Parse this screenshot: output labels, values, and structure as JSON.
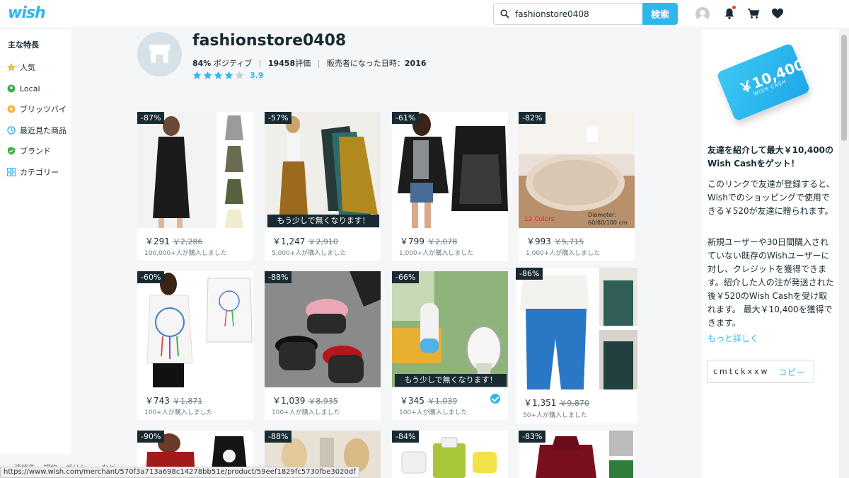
{
  "brand": {
    "logo_text": "wish",
    "accent": "#2fb7ec"
  },
  "search": {
    "value": "fashionstore0408",
    "button_label": "検索"
  },
  "sidebar": {
    "title": "主な特長",
    "items": [
      {
        "label": "人気",
        "icon": "star-icon"
      },
      {
        "label": "Local",
        "icon": "location-pin-icon"
      },
      {
        "label": "ブリッツバイ",
        "icon": "blitz-buy-icon"
      },
      {
        "label": "最近見た商品",
        "icon": "clock-icon"
      },
      {
        "label": "ブランド",
        "icon": "verified-shield-icon"
      },
      {
        "label": "カテゴリー",
        "icon": "grid-icon"
      }
    ]
  },
  "merchant": {
    "name": "fashionstore0408",
    "positive_pct": "84%",
    "positive_label": "ポジティブ",
    "review_count": "19458",
    "review_label": "評価",
    "since_label": "販売者になった日時：",
    "since_year": "2016",
    "rating": "3.9",
    "stars_filled": 4,
    "stars_total": 5
  },
  "products": [
    {
      "discount": "-87%",
      "price": "￥291",
      "orig": "￥2,286",
      "sold": "100,000+人が購入しました",
      "almost_gone": false,
      "verified": false
    },
    {
      "discount": "-57%",
      "price": "￥1,247",
      "orig": "￥2,910",
      "sold": "5,000+人が購入しました",
      "almost_gone": true,
      "verified": false
    },
    {
      "discount": "-61%",
      "price": "￥799",
      "orig": "￥2,078",
      "sold": "1,000+人が購入しました",
      "almost_gone": false,
      "verified": false
    },
    {
      "discount": "-82%",
      "price": "￥993",
      "orig": "￥5,715",
      "sold": "1,000+人が購入しました",
      "almost_gone": false,
      "verified": false,
      "overlay_colors": "12 Colors",
      "overlay_diameter": "Diameter:",
      "overlay_size": "60/80/100 cm"
    },
    {
      "discount": "-60%",
      "price": "￥743",
      "orig": "￥1,871",
      "sold": "100+人が購入しました",
      "almost_gone": false,
      "verified": false
    },
    {
      "discount": "-88%",
      "price": "￥1,039",
      "orig": "￥8,935",
      "sold": "100+人が購入しました",
      "almost_gone": false,
      "verified": false
    },
    {
      "discount": "-66%",
      "price": "￥345",
      "orig": "￥1,039",
      "sold": "100+人が購入しました",
      "almost_gone": true,
      "verified": true
    },
    {
      "discount": "-86%",
      "price": "￥1,351",
      "orig": "￥9,870",
      "sold": "50+人が購入しました",
      "almost_gone": false,
      "verified": false
    },
    {
      "discount": "-90%"
    },
    {
      "discount": "-88%"
    },
    {
      "discount": "-84%"
    },
    {
      "discount": "-83%"
    }
  ],
  "almost_gone_label": "もう少しで無くなります！",
  "promo": {
    "card_amount": "￥10,400",
    "card_sub": "WISH CASH",
    "title": "友達を紹介して最大￥10,400のWish Cashをゲット！",
    "p1": "このリンクで友達が登録すると、Wishでのショッピングで使用できる￥520が友達に贈られます。",
    "p2": "新規ユーザーや30日間購入されていない既存のWishユーザーに対し、クレジットを獲得できます。紹介した人の注が発送された後￥520のWish Cashを受け取れます。 最大￥10,400を獲得できます。",
    "learn_more": "もっと詳しく",
    "code": "cmtckxxw",
    "copy": "コピー"
  },
  "footer": {
    "links": [
      "連絡先",
      "規約",
      "ポリシー",
      "など"
    ]
  },
  "status_url": "https://www.wish.com/merchant/570f3a713a698c14278bb51e/product/59eef1829fc5730fbe3020df"
}
